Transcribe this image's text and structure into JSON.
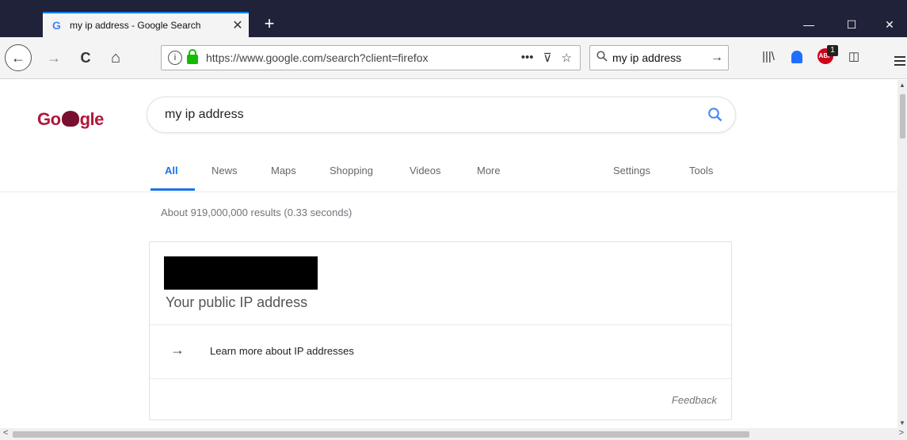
{
  "tab": {
    "favicon": "G",
    "title": "my ip address - Google Search",
    "close": "✕"
  },
  "newtab": "+",
  "window": {
    "minimize": "—",
    "maximize": "☐",
    "close": "✕"
  },
  "nav": {
    "back_icon": "←",
    "forward_icon": "→",
    "reload_icon": "C",
    "home_icon": "⌂",
    "url_info": "i",
    "url_text": "https://www.google.com/search?client=firefox",
    "url_more": "•••",
    "url_pocket": "⊽",
    "url_star": "☆",
    "search_icon": "🔍︎",
    "search_text": "my ip address",
    "search_go": "→",
    "library_icon": "|||\\",
    "sidebar_icon": "◫",
    "abp_text": "ABP",
    "abp_badge": "1"
  },
  "google": {
    "logo_left": "Go",
    "logo_right": "gle",
    "query": "my ip address",
    "tabs": [
      "All",
      "News",
      "Maps",
      "Shopping",
      "Videos",
      "More",
      "Settings",
      "Tools"
    ],
    "stats": "About 919,000,000 results (0.33 seconds)",
    "card": {
      "label": "Your public IP address",
      "learn_more": "Learn more about IP addresses",
      "arrow": "→",
      "feedback": "Feedback"
    }
  },
  "scroll": {
    "up": "▲",
    "down": "▼",
    "left": "<",
    "right": ">"
  },
  "colors": {
    "accent": "#1a73e8",
    "titlebar": "#1f2239",
    "lock": "#12bc00",
    "logo": "#b0193c"
  }
}
